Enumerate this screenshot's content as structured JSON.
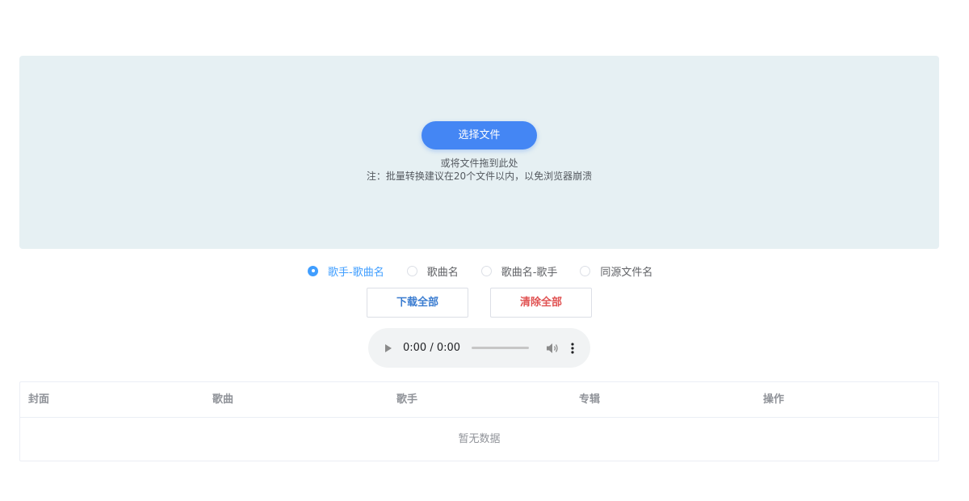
{
  "upload": {
    "select_button": "选择文件",
    "drag_hint": "或将文件拖到此处",
    "batch_note": "注：批量转换建议在20个文件以内，以免浏览器崩溃"
  },
  "naming": {
    "options": [
      {
        "label": "歌手-歌曲名",
        "checked": true
      },
      {
        "label": "歌曲名",
        "checked": false
      },
      {
        "label": "歌曲名-歌手",
        "checked": false
      },
      {
        "label": "同源文件名",
        "checked": false
      }
    ]
  },
  "actions": {
    "download_all": "下载全部",
    "clear_all": "清除全部"
  },
  "player": {
    "time": "0:00 / 0:00",
    "icons": [
      "play-icon",
      "volume-icon",
      "more-icon"
    ]
  },
  "table": {
    "columns": [
      "封面",
      "歌曲",
      "歌手",
      "专辑",
      "操作"
    ],
    "empty_text": "暂无数据"
  },
  "colors": {
    "accent": "#409eff",
    "primary_button": "#4486f4",
    "danger": "#e05252",
    "dropzone_bg": "#e6f0f3"
  }
}
